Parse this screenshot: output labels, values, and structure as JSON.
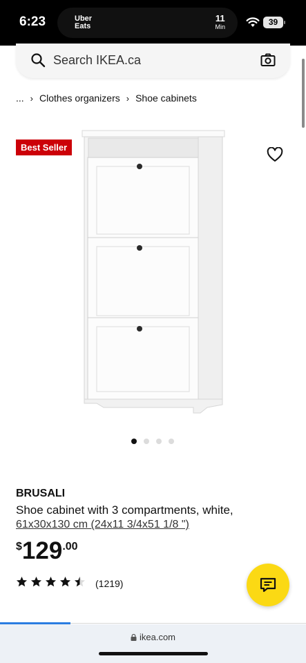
{
  "status_bar": {
    "time": "6:23",
    "island_app": "Uber Eats",
    "eta_number": "11",
    "eta_unit": "Min",
    "battery": "39"
  },
  "search": {
    "placeholder": "Search IKEA.ca"
  },
  "breadcrumb": {
    "ellipsis": "...",
    "items": [
      "Clothes organizers",
      "Shoe cabinets"
    ]
  },
  "badge": "Best Seller",
  "product": {
    "name": "BRUSALI",
    "description": "Shoe cabinet with 3 compartments, white,",
    "size": "61x30x130 cm (24x11 3/4x51 1/8 \")",
    "price_currency": "$",
    "price_main": "129",
    "price_cents": ".00",
    "rating_value": 4.5,
    "rating_max": 5,
    "review_count": "(1219)"
  },
  "gallery": {
    "total_images": 4,
    "active_index": 0
  },
  "browser": {
    "url": "ikea.com",
    "load_progress": 0.23
  },
  "colors": {
    "badge": "#cc0008",
    "chat_button": "#fbd914",
    "progress": "#2a7de1"
  }
}
